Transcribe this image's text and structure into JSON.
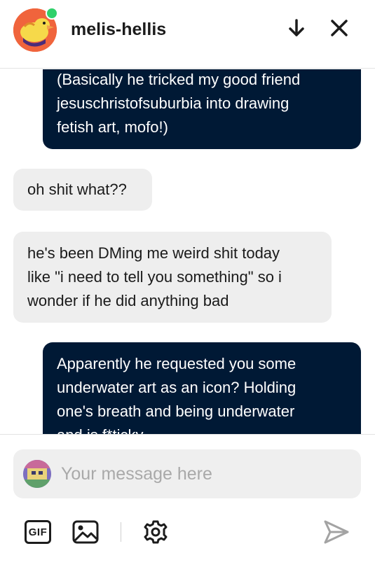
{
  "header": {
    "username": "melis-hellis"
  },
  "messages": [
    {
      "from": "me",
      "text_lines": [
        "(Basically he tricked my good friend",
        "jesuschristofsuburbia into drawing",
        "fetish art, mofo!)"
      ]
    },
    {
      "from": "them",
      "text_lines": [
        "oh shit what??"
      ]
    },
    {
      "from": "them",
      "text_lines": [
        "he's been DMing me weird shit today",
        "like \"i need to tell you something\" so i",
        "wonder if he did anything bad"
      ]
    },
    {
      "from": "me",
      "text_lines": [
        "Apparently he requested you some",
        "underwater art as an icon? Holding",
        "one's breath and being underwater",
        "and is f*ticky"
      ]
    }
  ],
  "composer": {
    "placeholder": "Your message here",
    "value": ""
  },
  "toolbar": {
    "gif_label": "GIF"
  },
  "colors": {
    "sent_bubble": "#001935",
    "received_bubble": "#eeeeee",
    "online": "#2fd06a",
    "avatar_bg": "#f0643c"
  },
  "icons": {
    "jump_down": "arrow-down-icon",
    "close": "close-icon",
    "gif": "gif-icon",
    "image": "image-icon",
    "settings": "gear-icon",
    "send": "send-icon"
  }
}
